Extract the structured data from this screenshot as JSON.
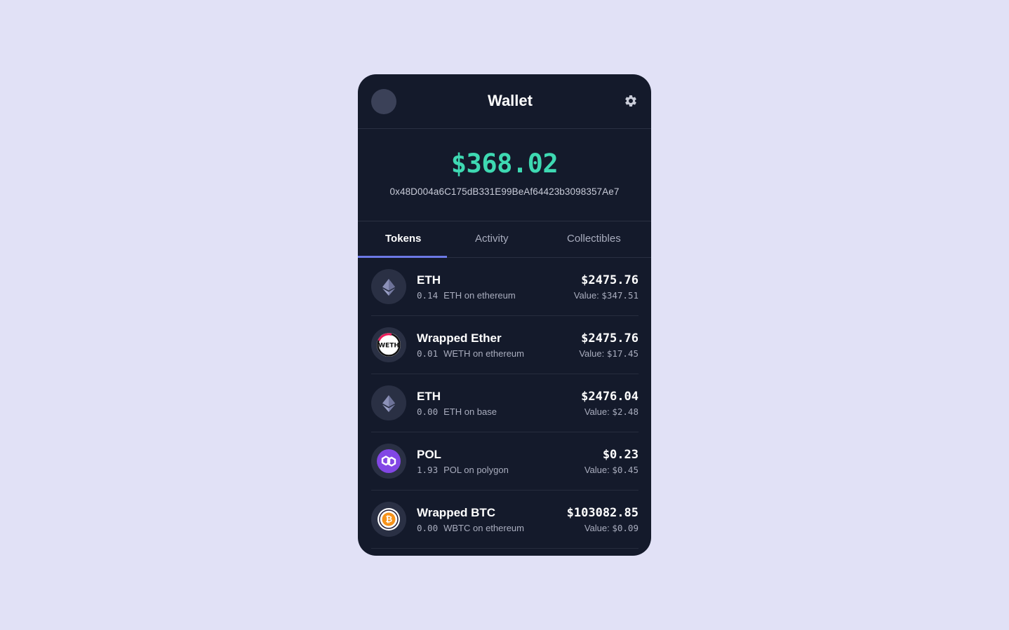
{
  "header": {
    "title": "Wallet"
  },
  "balance": {
    "total": "$368.02",
    "address": "0x48D004a6C175dB331E99BeAf64423b3098357Ae7"
  },
  "tabs": [
    {
      "label": "Tokens",
      "active": true
    },
    {
      "label": "Activity",
      "active": false
    },
    {
      "label": "Collectibles",
      "active": false
    }
  ],
  "tokens": [
    {
      "name": "ETH",
      "amount": "0.14",
      "detail": "ETH on ethereum",
      "price": "$2475.76",
      "value_label": "Value: ",
      "value": "$347.51",
      "icon": "ethereum-icon"
    },
    {
      "name": "Wrapped Ether",
      "amount": "0.01",
      "detail": "WETH on ethereum",
      "price": "$2475.76",
      "value_label": "Value: ",
      "value": "$17.45",
      "icon": "weth-icon",
      "icon_text": "WETH"
    },
    {
      "name": "ETH",
      "amount": "0.00",
      "detail": "ETH on base",
      "price": "$2476.04",
      "value_label": "Value: ",
      "value": "$2.48",
      "icon": "ethereum-icon"
    },
    {
      "name": "POL",
      "amount": "1.93",
      "detail": "POL on polygon",
      "price": "$0.23",
      "value_label": "Value: ",
      "value": "$0.45",
      "icon": "polygon-icon"
    },
    {
      "name": "Wrapped BTC",
      "amount": "0.00",
      "detail": "WBTC on ethereum",
      "price": "$103082.85",
      "value_label": "Value: ",
      "value": "$0.09",
      "icon": "bitcoin-icon"
    }
  ],
  "colors": {
    "background": "#e1e1f6",
    "card": "#141a2b",
    "balance": "#3ed9b2",
    "tab_accent": "#6c79e6",
    "polygon": "#8247e5",
    "bitcoin": "#f7931a",
    "weth_ring": "#ec1c5b"
  }
}
